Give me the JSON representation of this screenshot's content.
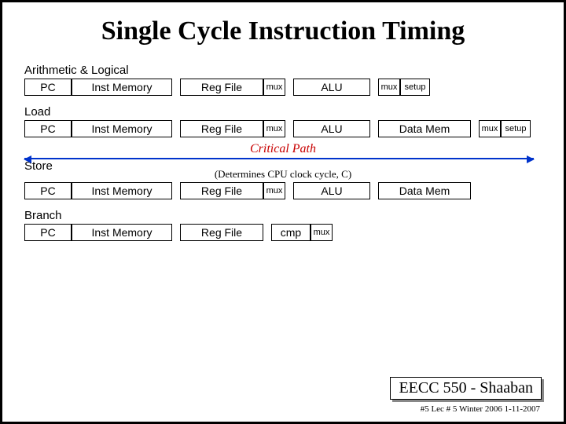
{
  "title": "Single Cycle Instruction Timing",
  "sections": {
    "arith": {
      "label": "Arithmetic & Logical"
    },
    "load": {
      "label": "Load"
    },
    "store": {
      "label": "Store"
    },
    "branch": {
      "label": "Branch"
    }
  },
  "stages": {
    "pc": "PC",
    "inst": "Inst Memory",
    "reg": "Reg File",
    "mux": "mux",
    "alu": "ALU",
    "data": "Data Mem",
    "setup": "setup",
    "cmp": "cmp"
  },
  "critical_path": "Critical Path",
  "determines": "(Determines CPU clock cycle, C)",
  "footer": {
    "course": "EECC 550 - Shaaban",
    "sub": "#5  Lec # 5  Winter 2006  1-11-2007"
  }
}
